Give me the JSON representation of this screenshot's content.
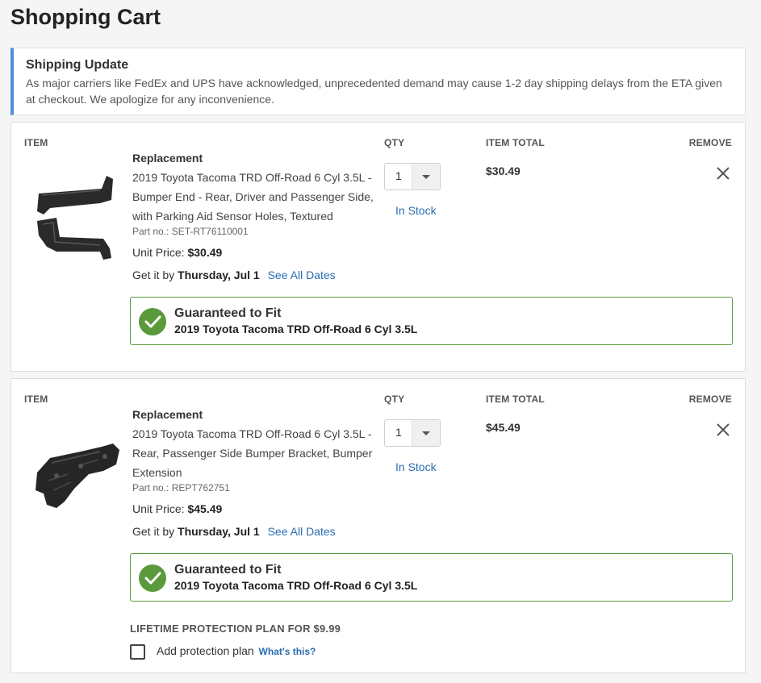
{
  "page": {
    "title": "Shopping Cart"
  },
  "notice": {
    "title": "Shipping Update",
    "text": "As major carriers like FedEx and UPS have acknowledged, unprecedented demand may cause 1-2 day shipping delays from the ETA given at checkout. We apologize for any inconvenience."
  },
  "columns": {
    "item": "ITEM",
    "qty": "QTY",
    "total": "ITEM TOTAL",
    "remove": "REMOVE"
  },
  "items": [
    {
      "brand": "Replacement",
      "name": "2019 Toyota Tacoma TRD Off-Road 6 Cyl 3.5L - Bumper End - Rear, Driver and Passenger Side, with Parking Aid Sensor Holes, Textured",
      "part_no": "Part no.: SET-RT76110001",
      "unit_price_label": "Unit Price:",
      "unit_price": "$30.49",
      "delivery_label": "Get it by",
      "delivery_date": "Thursday, Jul 1",
      "see_dates": "See All Dates",
      "qty": "1",
      "stock": "In Stock",
      "total": "$30.49",
      "fit_title": "Guaranteed to Fit",
      "fit_vehicle": "2019 Toyota Tacoma TRD Off-Road 6 Cyl 3.5L"
    },
    {
      "brand": "Replacement",
      "name": "2019 Toyota Tacoma TRD Off-Road 6 Cyl 3.5L - Rear, Passenger Side Bumper Bracket, Bumper Extension",
      "part_no": "Part no.: REPT762751",
      "unit_price_label": "Unit Price:",
      "unit_price": "$45.49",
      "delivery_label": "Get it by",
      "delivery_date": "Thursday, Jul 1",
      "see_dates": "See All Dates",
      "qty": "1",
      "stock": "In Stock",
      "total": "$45.49",
      "fit_title": "Guaranteed to Fit",
      "fit_vehicle": "2019 Toyota Tacoma TRD Off-Road 6 Cyl 3.5L",
      "protection": {
        "title": "LIFETIME PROTECTION PLAN FOR $9.99",
        "label": "Add protection plan",
        "link": "What's this?",
        "checked": false
      }
    }
  ],
  "icons": {
    "remove": "close-icon",
    "fit": "check-icon",
    "qty": "chevron-down-icon"
  },
  "colors": {
    "accent_blue": "#2b6cb0",
    "fit_green": "#5a9a3c",
    "notice_border": "#4a90d9"
  }
}
